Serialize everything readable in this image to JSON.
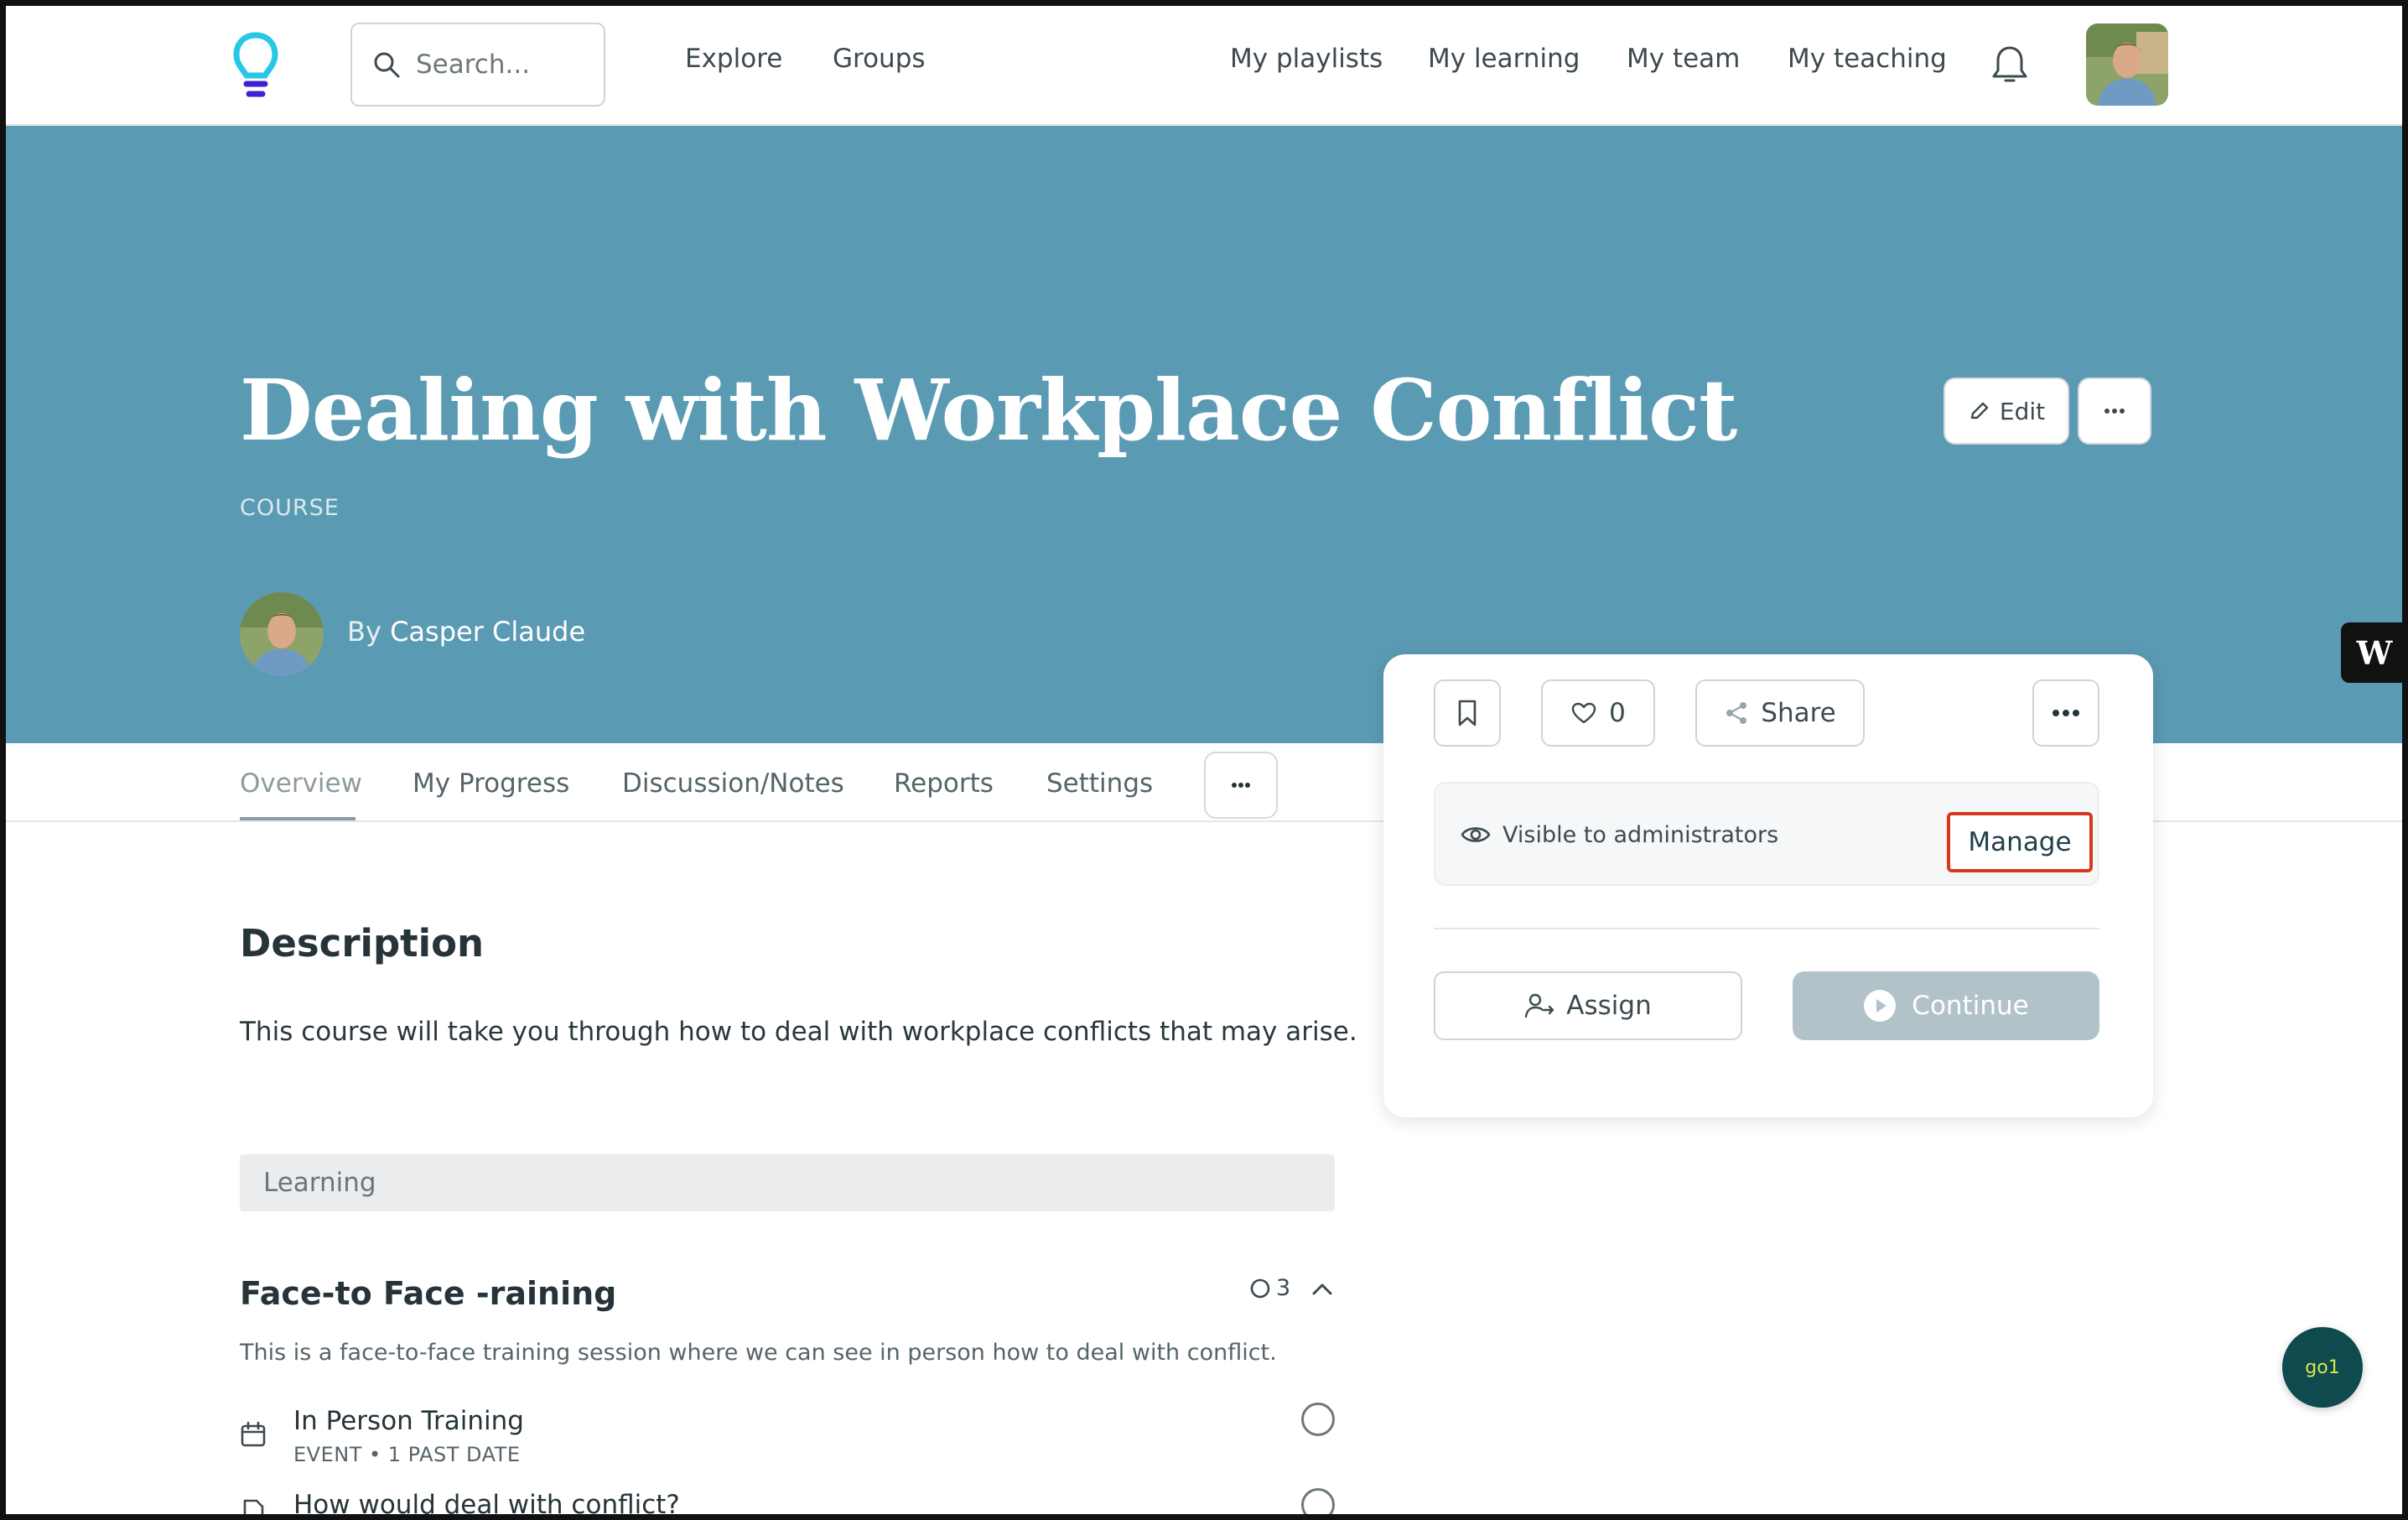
{
  "nav": {
    "search_placeholder": "Search...",
    "left_links": [
      "Explore",
      "Groups"
    ],
    "right_links": [
      "My playlists",
      "My learning",
      "My team",
      "My teaching"
    ]
  },
  "hero": {
    "title": "Dealing with Workplace Conflict",
    "type": "COURSE",
    "author_prefix": "By",
    "author_name": "Casper Claude",
    "edit_label": "Edit",
    "background_color": "#5a9bb3"
  },
  "tabs": [
    "Overview",
    "My Progress",
    "Discussion/Notes",
    "Reports",
    "Settings"
  ],
  "active_tab": "Overview",
  "content": {
    "description_title": "Description",
    "description_text": "This course will take you through how to deal with workplace conflicts that may arise.",
    "learning_label": "Learning",
    "section": {
      "title": "Face-to Face -raining",
      "count": "3",
      "description": "This is a face-to-face training session where we can see in person how to deal with conflict.",
      "items": [
        {
          "title": "In Person Training",
          "meta": "EVENT • 1 PAST DATE",
          "icon": "calendar-icon"
        },
        {
          "title": "How would deal with conflict?",
          "meta": "",
          "icon": "document-icon"
        }
      ]
    }
  },
  "card": {
    "like_count": "0",
    "share_label": "Share",
    "visibility_text": "Visible to administrators",
    "manage_label": "Manage",
    "assign_label": "Assign",
    "continue_label": "Continue",
    "manage_border_color": "#d9381e"
  },
  "widgets": {
    "w_label": "W",
    "go1_label": "go1"
  }
}
